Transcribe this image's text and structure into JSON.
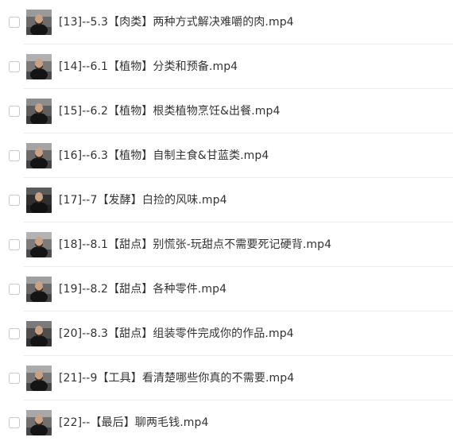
{
  "files": [
    {
      "name": "[13]--5.3【肉类】两种方式解决难嚼的肉.mp4",
      "thumbnail_icon": "video-thumbnail-icon"
    },
    {
      "name": "[14]--6.1【植物】分类和预备.mp4",
      "thumbnail_icon": "video-thumbnail-icon"
    },
    {
      "name": "[15]--6.2【植物】根类植物烹饪&出餐.mp4",
      "thumbnail_icon": "video-thumbnail-icon"
    },
    {
      "name": "[16]--6.3【植物】自制主食&甘蓝类.mp4",
      "thumbnail_icon": "video-thumbnail-icon"
    },
    {
      "name": "[17]--7【发酵】白捡的风味.mp4",
      "thumbnail_icon": "video-thumbnail-icon"
    },
    {
      "name": "[18]--8.1【甜点】别慌张-玩甜点不需要死记硬背.mp4",
      "thumbnail_icon": "video-thumbnail-icon"
    },
    {
      "name": "[19]--8.2【甜点】各种零件.mp4",
      "thumbnail_icon": "video-thumbnail-icon"
    },
    {
      "name": "[20]--8.3【甜点】组装零件完成你的作品.mp4",
      "thumbnail_icon": "video-thumbnail-icon"
    },
    {
      "name": "[21]--9【工具】看清楚哪些你真的不需要.mp4",
      "thumbnail_icon": "video-thumbnail-icon"
    },
    {
      "name": "[22]--【最后】聊两毛钱.mp4",
      "thumbnail_icon": "video-thumbnail-icon"
    }
  ],
  "colors": {
    "text": "#333333",
    "divider": "#ececec",
    "checkbox_border": "#c9c9c9",
    "background": "#ffffff"
  }
}
